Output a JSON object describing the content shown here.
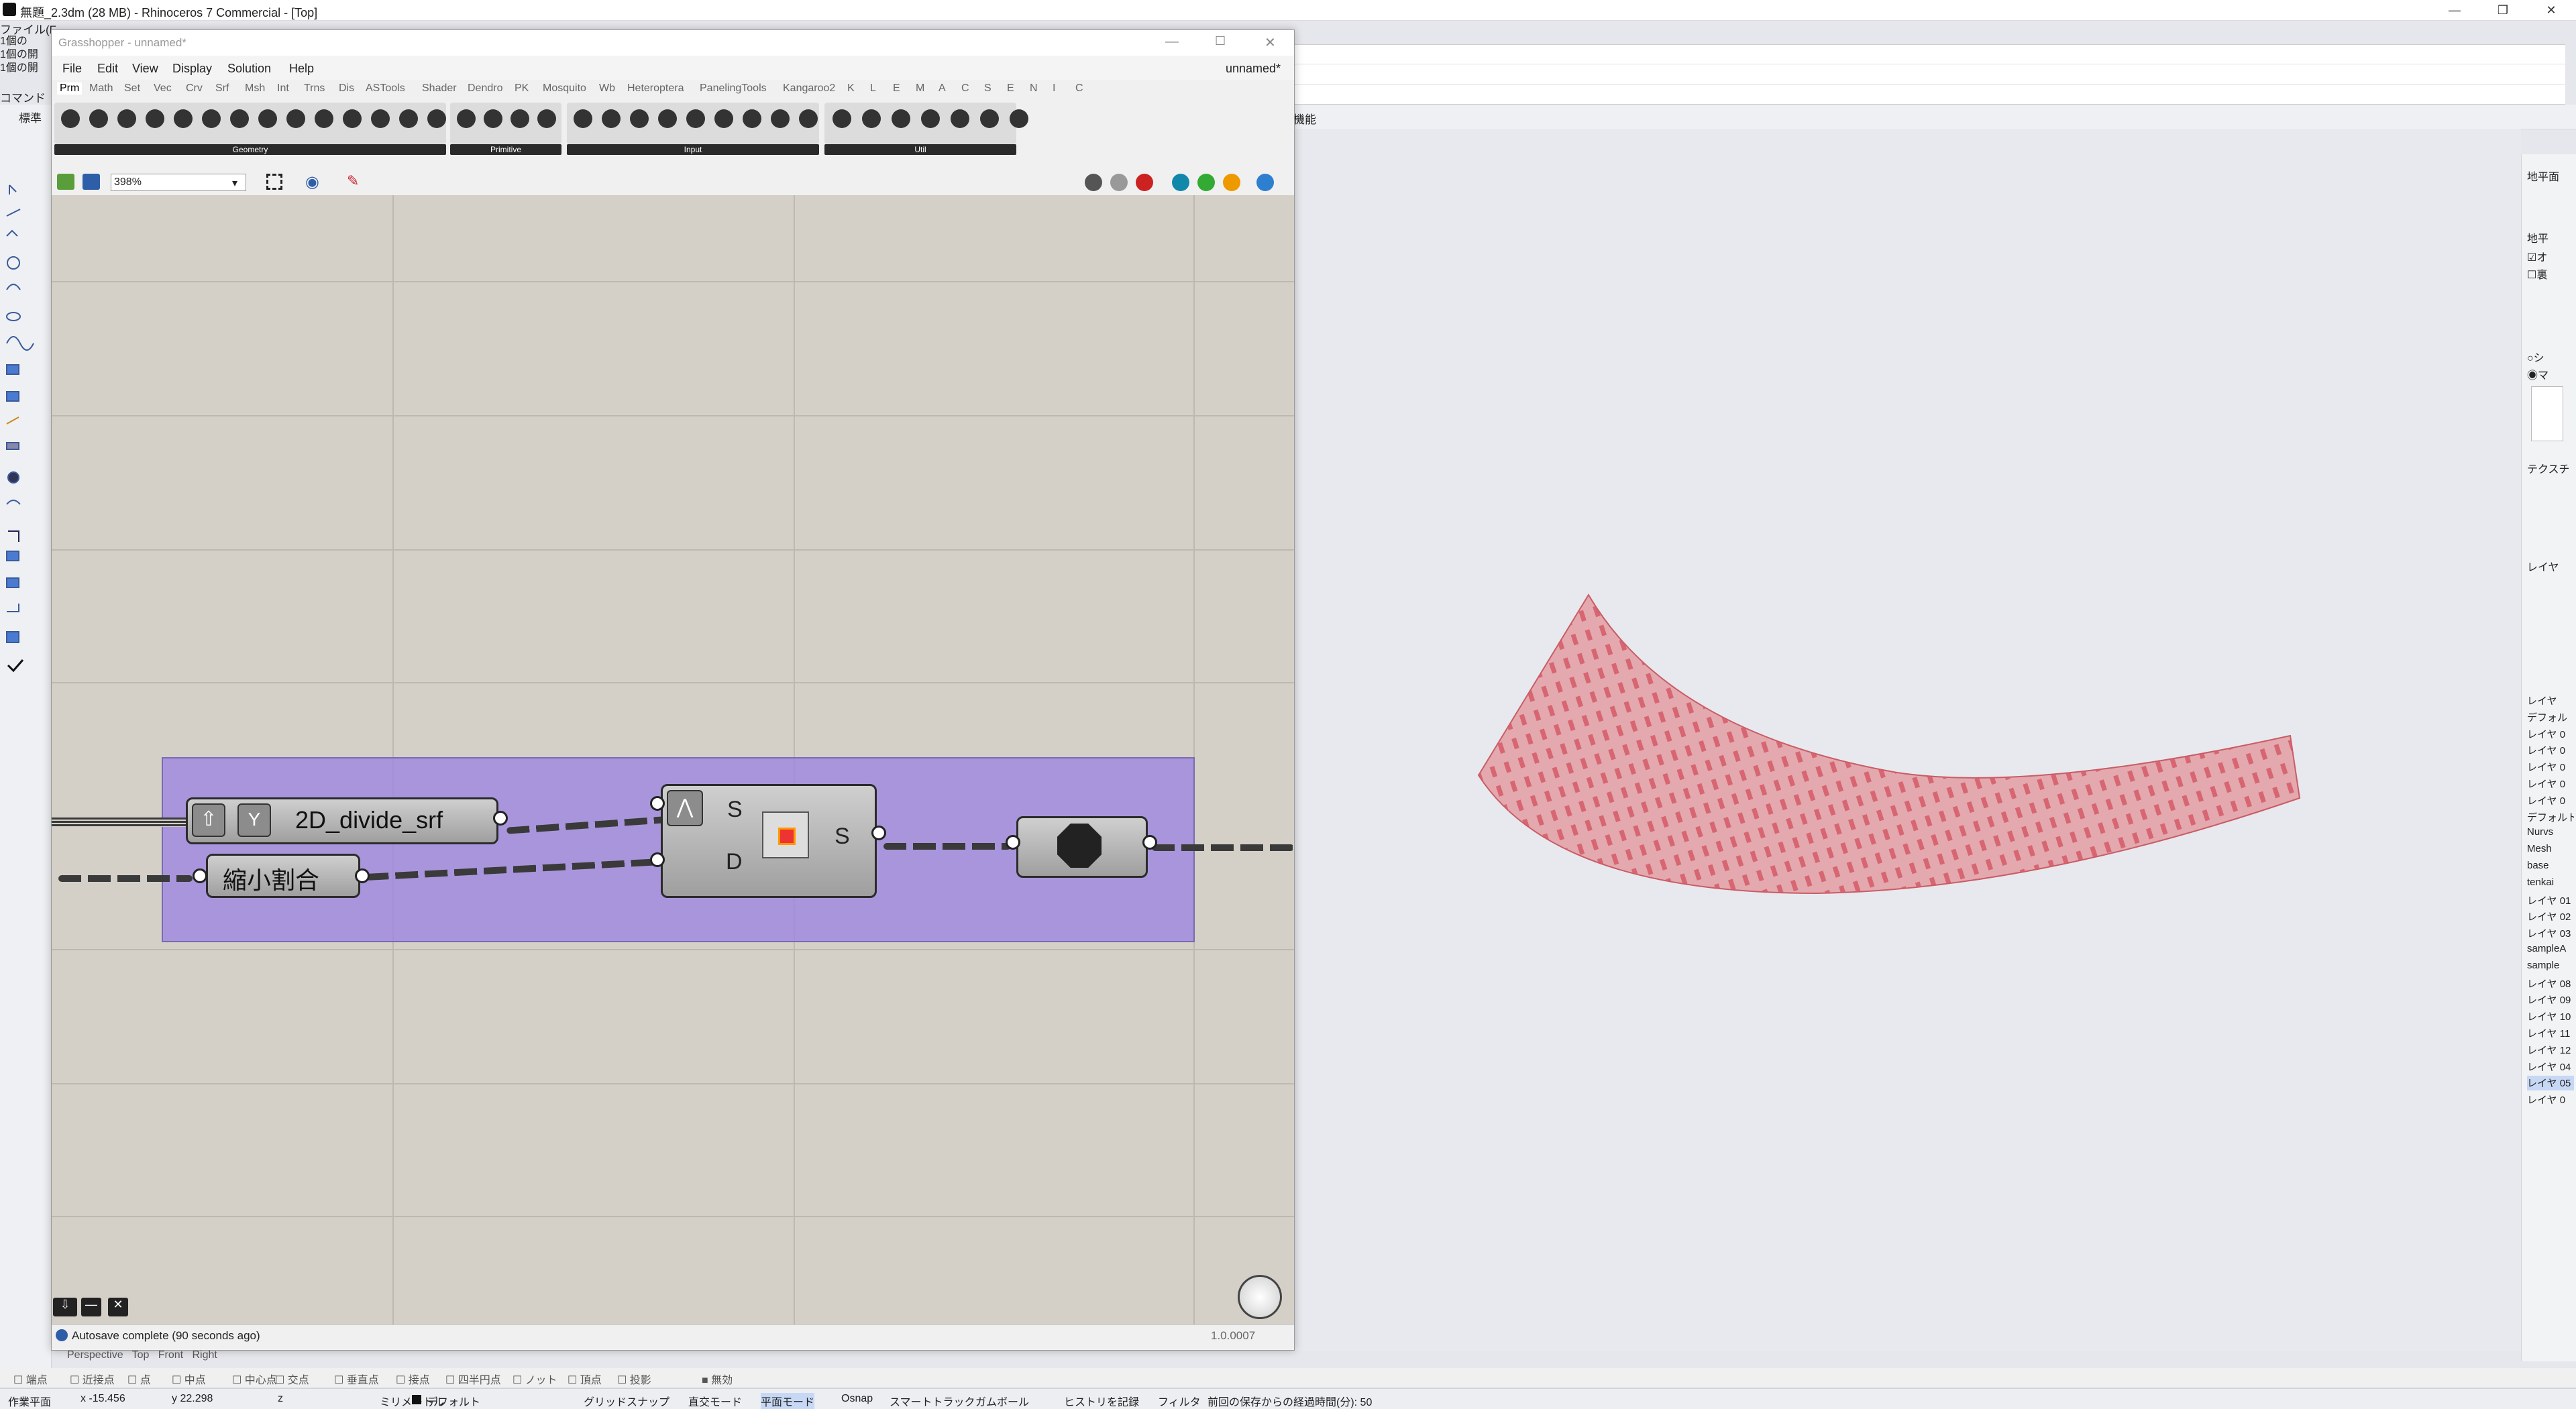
{
  "rhino": {
    "title": "無題_2.3dm (28 MB) - Rhinoceros 7 Commercial - [Top]",
    "menu_label": "ファイル(F",
    "history": [
      "1個の",
      "1個の開",
      "1個の開"
    ],
    "prompt": "コマンド",
    "toolbar_tab_standard": "標準",
    "toolbar_tab_right": "機能"
  },
  "grasshopper": {
    "title": "Grasshopper - unnamed*",
    "doc_name": "unnamed*",
    "menus": [
      "File",
      "Edit",
      "View",
      "Display",
      "Solution",
      "Help"
    ],
    "tabs": [
      "Prm",
      "Math",
      "Set",
      "Vec",
      "Crv",
      "Srf",
      "Msh",
      "Int",
      "Trns",
      "Dis",
      "ASTools",
      "Shader",
      "Dendro",
      "PK",
      "Mosquito",
      "Wb",
      "Heteroptera",
      "PanelingTools",
      "Kangaroo2",
      "K",
      "L",
      "E",
      "M",
      "A",
      "C",
      "S",
      "E",
      "N",
      "I",
      "C"
    ],
    "ribbon_groups": [
      "Geometry",
      "Primitive",
      "Input",
      "Util"
    ],
    "zoom": "398%",
    "components": {
      "cluster_name": "2D_divide_srf",
      "slider_label": "縮小割合",
      "input_s": "S",
      "input_d": "D",
      "output_s": "S"
    },
    "status": "Autosave complete (90 seconds ago)",
    "version": "1.0.0007"
  },
  "right_panel": {
    "labels_top": [
      "地平面",
      "地平"
    ],
    "checks": [
      "オ",
      "裏"
    ],
    "radios": [
      "シ",
      "マ"
    ],
    "tex_label": "テクスチ",
    "layer_header": "レイヤ",
    "layers": [
      "レイヤ",
      "デフォル",
      "レイヤ 0",
      "レイヤ 0",
      "レイヤ 0",
      "レイヤ 0",
      "レイヤ 0",
      "デフォルト",
      "Nurvs",
      "Mesh",
      "base",
      "tenkai",
      "レイヤ 01",
      "レイヤ 02",
      "レイヤ 03",
      "sampleA",
      "sample",
      "レイヤ 08",
      "レイヤ 09",
      "レイヤ 10",
      "レイヤ 11",
      "レイヤ 12",
      "レイヤ 04",
      "レイヤ 05",
      "レイヤ 0"
    ]
  },
  "views": {
    "tabs": [
      "Perspective",
      "Top",
      "Front",
      "Right"
    ]
  },
  "osnaps": [
    "端点",
    "近接点",
    "点",
    "中点",
    "中心点",
    "交点",
    "垂直点",
    "接点",
    "四半円点",
    "ノット",
    "頂点",
    "投影",
    "無効"
  ],
  "status": {
    "plane": "作業平面",
    "x": "x -15.456",
    "y": "y 22.298",
    "z": "z",
    "unit": "ミリメートル",
    "layer": "デフォルト",
    "items": [
      "グリッドスナップ",
      "直交モード",
      "平面モード",
      "Osnap",
      "スマートトラック",
      "ガムボール",
      "ヒストリを記録",
      "フィルタ",
      "前回の保存からの経過時間(分): 50"
    ]
  },
  "colors": {
    "group": "#a087e1",
    "surface_fill": "#e3a9ae",
    "surface_stroke": "#c95c66",
    "highlight": "#c7d8f5"
  }
}
